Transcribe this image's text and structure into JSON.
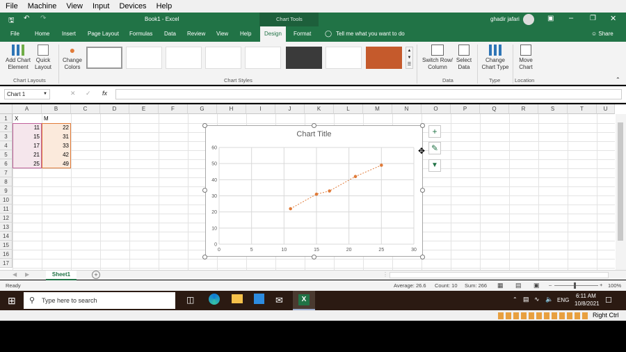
{
  "vm_menu": [
    "File",
    "Machine",
    "View",
    "Input",
    "Devices",
    "Help"
  ],
  "titlebar": {
    "doc_title": "Book1 - Excel",
    "tools_label": "Chart Tools",
    "user": "ghadir jafari"
  },
  "ribbon_tabs": [
    "File",
    "Home",
    "Insert",
    "Page Layout",
    "Formulas",
    "Data",
    "Review",
    "View",
    "Help",
    "Design",
    "Format"
  ],
  "tell_me": "Tell me what you want to do",
  "share": "Share",
  "ribbon": {
    "add_chart": "Add Chart\nElement",
    "quick_layout": "Quick\nLayout",
    "change_colors": "Change\nColors",
    "chart_layouts": "Chart Layouts",
    "chart_styles": "Chart Styles",
    "switch_row_col": "Switch Row/\nColumn",
    "select_data": "Select\nData",
    "data_group": "Data",
    "change_type": "Change\nChart Type",
    "type_group": "Type",
    "move_chart": "Move\nChart",
    "location_group": "Location"
  },
  "name_box": "Chart 1",
  "columns": [
    "A",
    "B",
    "C",
    "D",
    "E",
    "F",
    "G",
    "H",
    "I",
    "J",
    "K",
    "L",
    "M",
    "N",
    "O",
    "P",
    "Q",
    "R",
    "S",
    "T",
    "U"
  ],
  "rows": [
    "1",
    "2",
    "3",
    "4",
    "5",
    "6",
    "7",
    "8",
    "9",
    "10",
    "11",
    "12",
    "13",
    "14",
    "15",
    "16",
    "17"
  ],
  "headers": {
    "a": "X",
    "b": "M"
  },
  "table": {
    "x": [
      "11",
      "15",
      "17",
      "21",
      "25"
    ],
    "m": [
      "22",
      "31",
      "33",
      "42",
      "49"
    ]
  },
  "chart_data": {
    "type": "scatter",
    "title": "Chart Title",
    "x": [
      11,
      15,
      17,
      21,
      25
    ],
    "y": [
      22,
      31,
      33,
      42,
      49
    ],
    "xlim": [
      0,
      30
    ],
    "ylim": [
      0,
      60
    ],
    "xticks": [
      "0",
      "5",
      "10",
      "15",
      "20",
      "25",
      "30"
    ],
    "yticks": [
      "0",
      "10",
      "20",
      "30",
      "40",
      "50",
      "60"
    ],
    "grid": true,
    "color": "#e07b39"
  },
  "sheet_tab": "Sheet1",
  "status": {
    "ready": "Ready",
    "average": "Average: 26.6",
    "count": "Count: 10",
    "sum": "Sum: 266",
    "zoom": "100%"
  },
  "taskbar": {
    "search_placeholder": "Type here to search",
    "lang": "ENG",
    "time": "6:11 AM",
    "date": "10/8/2021"
  },
  "vm_status": {
    "host_key": "Right Ctrl"
  },
  "colors": {
    "excel_green": "#217346",
    "orange": "#e07b39"
  }
}
